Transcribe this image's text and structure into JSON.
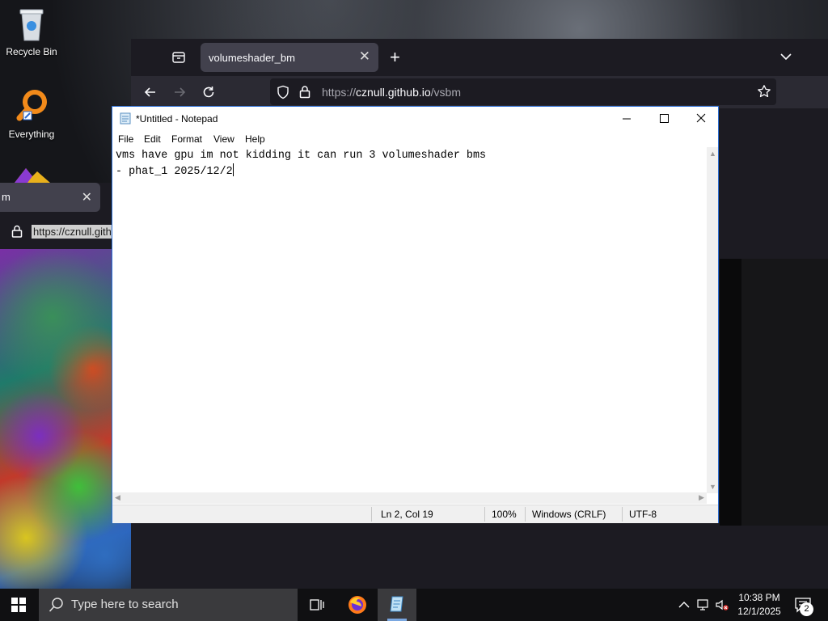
{
  "desktop": {
    "icons": [
      {
        "label": "Recycle Bin",
        "icon": "recycle-bin-icon"
      },
      {
        "label": "Everything",
        "icon": "everything-search-icon"
      }
    ]
  },
  "background_browser": {
    "tab_fragment": "m",
    "url_fragment": "https://cznull.gith"
  },
  "browser": {
    "tab_title": "volumeshader_bm",
    "url_prefix": "https://",
    "url_host": "cznull.github.io",
    "url_path": "/vsbm"
  },
  "notepad": {
    "title": "*Untitled - Notepad",
    "menu": [
      "File",
      "Edit",
      "Format",
      "View",
      "Help"
    ],
    "lines": [
      "vms have gpu im not kidding it can run 3 volumeshader bms",
      "- phat_1 2025/12/2"
    ],
    "status": {
      "position": "Ln 2, Col 19",
      "zoom": "100%",
      "line_ending": "Windows (CRLF)",
      "encoding": "UTF-8"
    }
  },
  "taskbar": {
    "search_placeholder": "Type here to search",
    "time": "10:38 PM",
    "date": "12/1/2025",
    "notification_count": "2"
  },
  "colors": {
    "browser_bg": "#1c1b22",
    "tab_active": "#42414d",
    "taskbar": "#101012",
    "notepad_border": "#2b6fd6"
  }
}
